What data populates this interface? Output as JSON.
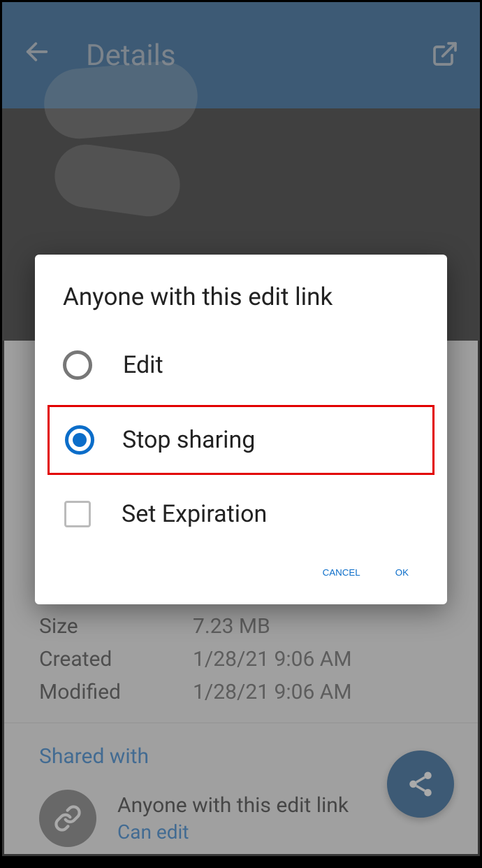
{
  "header": {
    "title": "Details"
  },
  "info": {
    "size_label": "Size",
    "size_value": "7.23 MB",
    "created_label": "Created",
    "created_value": "1/28/21 9:06 AM",
    "modified_label": "Modified",
    "modified_value": "1/28/21 9:06 AM"
  },
  "shared": {
    "section_title": "Shared with",
    "main": "Anyone with this edit link",
    "sub": "Can edit"
  },
  "dialog": {
    "title": "Anyone with this edit link",
    "option_edit": "Edit",
    "option_stop": "Stop sharing",
    "option_expire": "Set Expiration",
    "cancel": "CANCEL",
    "ok": "OK"
  }
}
